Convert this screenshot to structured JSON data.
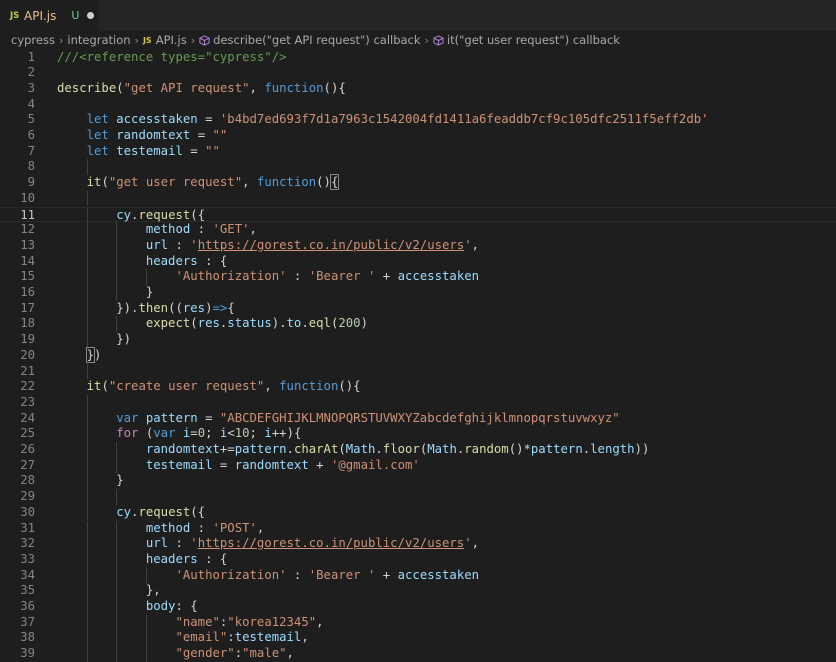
{
  "tab": {
    "icon": "js-file-icon",
    "js_label": "JS",
    "file_name": "API.js",
    "status": "U"
  },
  "breadcrumb": {
    "items": [
      "cypress",
      "integration",
      "API.js",
      "describe(\"get API request\") callback",
      "it(\"get user request\") callback"
    ]
  },
  "editor": {
    "active_line": 11,
    "lines": [
      [
        [
          "c",
          "///<reference types=\"cypress\"/>"
        ]
      ],
      [],
      [
        [
          "f",
          "describe"
        ],
        [
          "p",
          "("
        ],
        [
          "s",
          "\"get API request\""
        ],
        [
          "p",
          ", "
        ],
        [
          "k",
          "function"
        ],
        [
          "p",
          "(){"
        ]
      ],
      [],
      [
        [
          "p",
          "    "
        ],
        [
          "k",
          "let"
        ],
        [
          "p",
          " "
        ],
        [
          "v",
          "accesstaken"
        ],
        [
          "p",
          " = "
        ],
        [
          "s",
          "'b4bd7ed693f7d1a7963c1542004fd1411a6feaddb7cf9c105dfc2511f5eff2db'"
        ]
      ],
      [
        [
          "p",
          "    "
        ],
        [
          "k",
          "let"
        ],
        [
          "p",
          " "
        ],
        [
          "v",
          "randomtext"
        ],
        [
          "p",
          " = "
        ],
        [
          "s",
          "\"\""
        ]
      ],
      [
        [
          "p",
          "    "
        ],
        [
          "k",
          "let"
        ],
        [
          "p",
          " "
        ],
        [
          "v",
          "testemail"
        ],
        [
          "p",
          " = "
        ],
        [
          "s",
          "\"\""
        ]
      ],
      [],
      [
        [
          "p",
          "    "
        ],
        [
          "f",
          "it"
        ],
        [
          "p",
          "("
        ],
        [
          "s",
          "\"get user request\""
        ],
        [
          "p",
          ", "
        ],
        [
          "k",
          "function"
        ],
        [
          "p",
          "()"
        ],
        [
          "b",
          "{"
        ]
      ],
      [],
      [
        [
          "p",
          "        "
        ],
        [
          "v",
          "cy"
        ],
        [
          "p",
          "."
        ],
        [
          "f",
          "request"
        ],
        [
          "p",
          "({"
        ]
      ],
      [
        [
          "p",
          "            "
        ],
        [
          "v",
          "method"
        ],
        [
          "p",
          " : "
        ],
        [
          "s",
          "'GET'"
        ],
        [
          "p",
          ","
        ]
      ],
      [
        [
          "p",
          "            "
        ],
        [
          "v",
          "url"
        ],
        [
          "p",
          " : "
        ],
        [
          "s",
          "'"
        ],
        [
          "u",
          "https://gorest.co.in/public/v2/users"
        ],
        [
          "s",
          "'"
        ],
        [
          "p",
          ","
        ]
      ],
      [
        [
          "p",
          "            "
        ],
        [
          "v",
          "headers"
        ],
        [
          "p",
          " : {"
        ]
      ],
      [
        [
          "p",
          "                "
        ],
        [
          "s",
          "'Authorization'"
        ],
        [
          "p",
          " : "
        ],
        [
          "s",
          "'Bearer '"
        ],
        [
          "p",
          " + "
        ],
        [
          "v",
          "accesstaken"
        ]
      ],
      [
        [
          "p",
          "            }"
        ]
      ],
      [
        [
          "p",
          "        })."
        ],
        [
          "f",
          "then"
        ],
        [
          "p",
          "(("
        ],
        [
          "v",
          "res"
        ],
        [
          "p",
          ")"
        ],
        [
          "k",
          "=>"
        ],
        [
          "p",
          "{"
        ]
      ],
      [
        [
          "p",
          "            "
        ],
        [
          "f",
          "expect"
        ],
        [
          "p",
          "("
        ],
        [
          "v",
          "res"
        ],
        [
          "p",
          "."
        ],
        [
          "v",
          "status"
        ],
        [
          "p",
          ")."
        ],
        [
          "v",
          "to"
        ],
        [
          "p",
          "."
        ],
        [
          "f",
          "eql"
        ],
        [
          "p",
          "("
        ],
        [
          "n",
          "200"
        ],
        [
          "p",
          ")"
        ]
      ],
      [
        [
          "p",
          "        })"
        ]
      ],
      [
        [
          "p",
          "    "
        ],
        [
          "b",
          "}"
        ],
        [
          "p",
          ")"
        ]
      ],
      [],
      [
        [
          "p",
          "    "
        ],
        [
          "f",
          "it"
        ],
        [
          "p",
          "("
        ],
        [
          "s",
          "\"create user request\""
        ],
        [
          "p",
          ", "
        ],
        [
          "k",
          "function"
        ],
        [
          "p",
          "(){"
        ]
      ],
      [],
      [
        [
          "p",
          "        "
        ],
        [
          "k",
          "var"
        ],
        [
          "p",
          " "
        ],
        [
          "v",
          "pattern"
        ],
        [
          "p",
          " = "
        ],
        [
          "s",
          "\"ABCDEFGHIJKLMNOPQRSTUVWXYZabcdefghijklmnopqrstuvwxyz\""
        ]
      ],
      [
        [
          "p",
          "        "
        ],
        [
          "kw",
          "for"
        ],
        [
          "p",
          " ("
        ],
        [
          "k",
          "var"
        ],
        [
          "p",
          " "
        ],
        [
          "v",
          "i"
        ],
        [
          "p",
          "="
        ],
        [
          "n",
          "0"
        ],
        [
          "p",
          "; "
        ],
        [
          "v",
          "i"
        ],
        [
          "p",
          "<"
        ],
        [
          "n",
          "10"
        ],
        [
          "p",
          "; "
        ],
        [
          "v",
          "i"
        ],
        [
          "p",
          "++){"
        ]
      ],
      [
        [
          "p",
          "            "
        ],
        [
          "v",
          "randomtext"
        ],
        [
          "p",
          "+="
        ],
        [
          "v",
          "pattern"
        ],
        [
          "p",
          "."
        ],
        [
          "f",
          "charAt"
        ],
        [
          "p",
          "("
        ],
        [
          "v",
          "Math"
        ],
        [
          "p",
          "."
        ],
        [
          "f",
          "floor"
        ],
        [
          "p",
          "("
        ],
        [
          "v",
          "Math"
        ],
        [
          "p",
          "."
        ],
        [
          "f",
          "random"
        ],
        [
          "p",
          "()*"
        ],
        [
          "v",
          "pattern"
        ],
        [
          "p",
          "."
        ],
        [
          "v",
          "length"
        ],
        [
          "p",
          "))"
        ]
      ],
      [
        [
          "p",
          "            "
        ],
        [
          "v",
          "testemail"
        ],
        [
          "p",
          " = "
        ],
        [
          "v",
          "randomtext"
        ],
        [
          "p",
          " + "
        ],
        [
          "s",
          "'@gmail.com'"
        ]
      ],
      [
        [
          "p",
          "        }"
        ]
      ],
      [],
      [
        [
          "p",
          "        "
        ],
        [
          "v",
          "cy"
        ],
        [
          "p",
          "."
        ],
        [
          "f",
          "request"
        ],
        [
          "p",
          "({"
        ]
      ],
      [
        [
          "p",
          "            "
        ],
        [
          "v",
          "method"
        ],
        [
          "p",
          " : "
        ],
        [
          "s",
          "'POST'"
        ],
        [
          "p",
          ","
        ]
      ],
      [
        [
          "p",
          "            "
        ],
        [
          "v",
          "url"
        ],
        [
          "p",
          " : "
        ],
        [
          "s",
          "'"
        ],
        [
          "u",
          "https://gorest.co.in/public/v2/users"
        ],
        [
          "s",
          "'"
        ],
        [
          "p",
          ","
        ]
      ],
      [
        [
          "p",
          "            "
        ],
        [
          "v",
          "headers"
        ],
        [
          "p",
          " : {"
        ]
      ],
      [
        [
          "p",
          "                "
        ],
        [
          "s",
          "'Authorization'"
        ],
        [
          "p",
          " : "
        ],
        [
          "s",
          "'Bearer '"
        ],
        [
          "p",
          " + "
        ],
        [
          "v",
          "accesstaken"
        ]
      ],
      [
        [
          "p",
          "            },"
        ]
      ],
      [
        [
          "p",
          "            "
        ],
        [
          "v",
          "body"
        ],
        [
          "p",
          ": {"
        ]
      ],
      [
        [
          "p",
          "                "
        ],
        [
          "s",
          "\"name\""
        ],
        [
          "p",
          ":"
        ],
        [
          "s",
          "\"korea12345\""
        ],
        [
          "p",
          ","
        ]
      ],
      [
        [
          "p",
          "                "
        ],
        [
          "s",
          "\"email\""
        ],
        [
          "p",
          ":"
        ],
        [
          "v",
          "testemail"
        ],
        [
          "p",
          ","
        ]
      ],
      [
        [
          "p",
          "                "
        ],
        [
          "s",
          "\"gender\""
        ],
        [
          "p",
          ":"
        ],
        [
          "s",
          "\"male\""
        ],
        [
          "p",
          ","
        ]
      ]
    ]
  },
  "colors": {
    "editor_bg": "#1e1e1e",
    "keyword": "#569cd6",
    "string": "#ce9178",
    "function": "#dcdcaa",
    "variable": "#9cdcfe",
    "number": "#b5cea8",
    "comment": "#6a9955",
    "control": "#c586c0",
    "tab_name": "#e2c08d",
    "untracked": "#73c991"
  }
}
